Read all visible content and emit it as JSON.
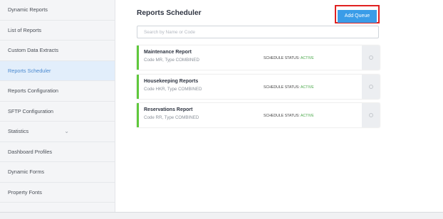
{
  "sidebar": {
    "items": [
      {
        "label": "Dynamic Reports"
      },
      {
        "label": "List of Reports"
      },
      {
        "label": "Custom Data Extracts"
      },
      {
        "label": "Reports Scheduler"
      },
      {
        "label": "Reports Configuration"
      },
      {
        "label": "SFTP Configuration"
      },
      {
        "label": "Statistics"
      },
      {
        "label": "Dashboard Profiles"
      },
      {
        "label": "Dynamic Forms"
      },
      {
        "label": "Property Fonts"
      }
    ],
    "active_item": "Reports Scheduler",
    "statistics_chevron": "chevron-down-icon"
  },
  "header": {
    "title": "Reports Scheduler",
    "add_button_label": "Add Queue",
    "highlight_color": "#e02020"
  },
  "search": {
    "placeholder": "Search by Name or Code",
    "value": ""
  },
  "reports": [
    {
      "name": "Maintenance Report",
      "code_label": "Code",
      "code": "MR",
      "type_label": ", Type",
      "type": "COMBINED",
      "status_label": "SCHEDULE STATUS:",
      "status": "ACTIVE"
    },
    {
      "name": "Housekeeping Reports",
      "code_label": "Code",
      "code": "HKR",
      "type_label": ", Type",
      "type": "COMBINED",
      "status_label": "SCHEDULE STATUS:",
      "status": "ACTIVE"
    },
    {
      "name": "Reservations Report",
      "code_label": "Code",
      "code": "RR",
      "type_label": ", Type",
      "type": "COMBINED",
      "status_label": "SCHEDULE STATUS:",
      "status": "ACTIVE"
    }
  ],
  "colors": {
    "accent": "#3a9ce8",
    "status_active": "#4aa84a",
    "card_border": "#5fc83c"
  }
}
